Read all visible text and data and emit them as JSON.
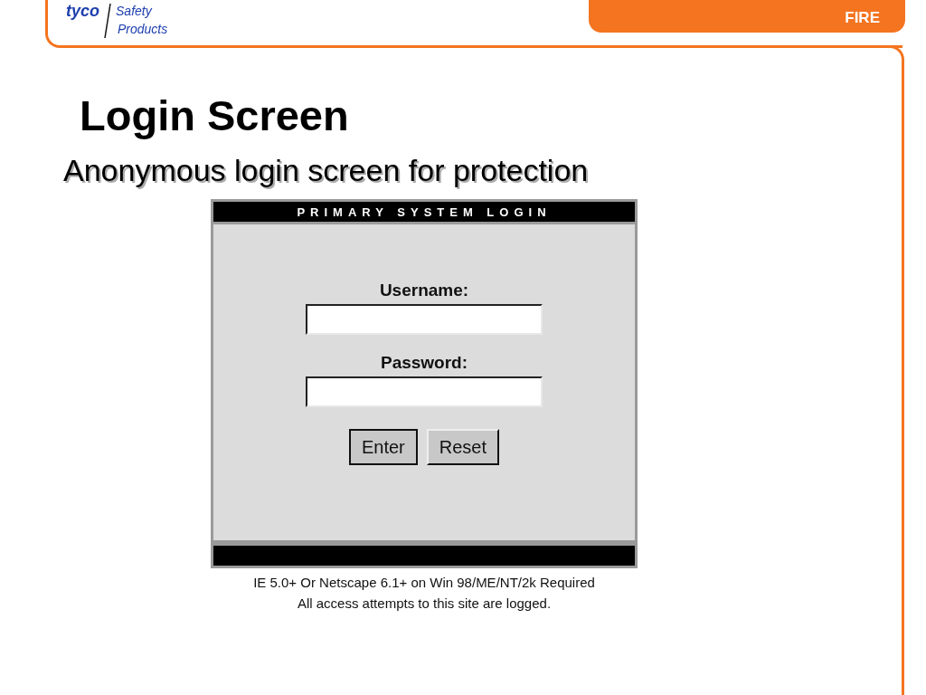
{
  "header": {
    "logo_mark": "tyco",
    "logo_lines": [
      "Safety",
      "Products"
    ],
    "section": "FIRE"
  },
  "slide": {
    "title": "Login Screen",
    "subtitle": "Anonymous login screen for protection"
  },
  "login": {
    "title": "PRIMARY SYSTEM LOGIN",
    "fields": [
      {
        "label": "Username:"
      },
      {
        "label": "Password:"
      }
    ],
    "buttons": [
      "Enter",
      "Reset"
    ],
    "notes": [
      "IE 5.0+ Or Netscape 6.1+ on Win 98/ME/NT/2k Required",
      "All access attempts to this site are logged."
    ]
  }
}
